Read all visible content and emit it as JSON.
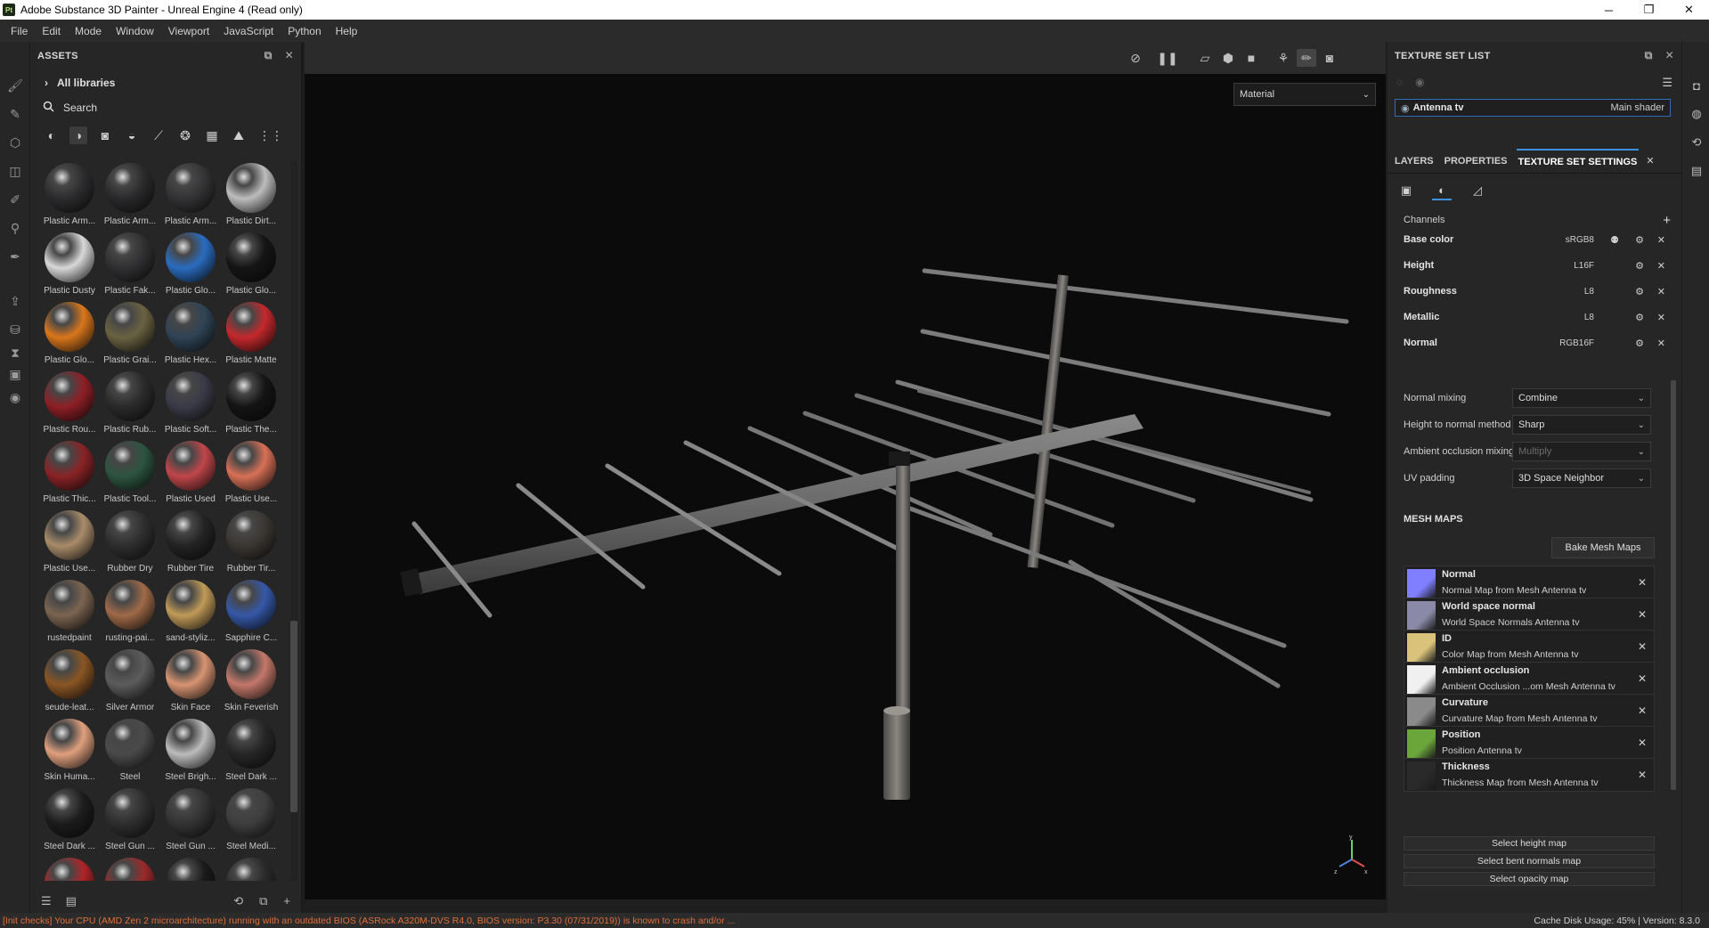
{
  "window": {
    "logo": "Pt",
    "title": "Adobe Substance 3D Painter - Unreal Engine 4 (Read only)",
    "controls": {
      "minimize": "─",
      "maximize": "❐",
      "close": "✕"
    }
  },
  "menu": [
    "File",
    "Edit",
    "Mode",
    "Window",
    "Viewport",
    "JavaScript",
    "Python",
    "Help"
  ],
  "assets": {
    "header": "ASSETS",
    "library": "All libraries",
    "search_placeholder": "Search",
    "items": [
      {
        "label": "Plastic Arm...",
        "color": "#2c2c2e"
      },
      {
        "label": "Plastic Arm...",
        "color": "#2a2a2c"
      },
      {
        "label": "Plastic Arm...",
        "color": "#333335"
      },
      {
        "label": "Plastic Dirt...",
        "color": "#bdbdbd"
      },
      {
        "label": "Plastic Dusty",
        "color": "#d8d8d8"
      },
      {
        "label": "Plastic Fak...",
        "color": "#303032"
      },
      {
        "label": "Plastic Glo...",
        "color": "#2a6cc0"
      },
      {
        "label": "Plastic Glo...",
        "color": "#151515"
      },
      {
        "label": "Plastic Glo...",
        "color": "#d9771c"
      },
      {
        "label": "Plastic Grai...",
        "color": "#6b6241"
      },
      {
        "label": "Plastic Hex...",
        "color": "#2f4456"
      },
      {
        "label": "Plastic Matte",
        "color": "#c5282c"
      },
      {
        "label": "Plastic Rou...",
        "color": "#8e1f26"
      },
      {
        "label": "Plastic Rub...",
        "color": "#2a2a2a"
      },
      {
        "label": "Plastic Soft...",
        "color": "#3a3a48"
      },
      {
        "label": "Plastic The...",
        "color": "#141414"
      },
      {
        "label": "Plastic Thic...",
        "color": "#8a2326"
      },
      {
        "label": "Plastic Tool...",
        "color": "#2c5440"
      },
      {
        "label": "Plastic Used",
        "color": "#c0464a"
      },
      {
        "label": "Plastic Use...",
        "color": "#d87056"
      },
      {
        "label": "Plastic Use...",
        "color": "#a98c6a"
      },
      {
        "label": "Rubber Dry",
        "color": "#2e2e2e"
      },
      {
        "label": "Rubber Tire",
        "color": "#232323"
      },
      {
        "label": "Rubber Tir...",
        "color": "#3a3632"
      },
      {
        "label": "rustedpaint",
        "color": "#7b6450"
      },
      {
        "label": "rusting-pai...",
        "color": "#a06a48"
      },
      {
        "label": "sand-styliz...",
        "color": "#c09a58"
      },
      {
        "label": "Sapphire C...",
        "color": "#3558a8"
      },
      {
        "label": "seude-leat...",
        "color": "#8a5524"
      },
      {
        "label": "Silver Armor",
        "color": "#5c5c5c"
      },
      {
        "label": "Skin Face",
        "color": "#d89472"
      },
      {
        "label": "Skin Feverish",
        "color": "#c4786a"
      },
      {
        "label": "Skin Huma...",
        "color": "#e0a07e"
      },
      {
        "label": "Steel",
        "color": "#4a4a4a"
      },
      {
        "label": "Steel Brigh...",
        "color": "#bcbcbc"
      },
      {
        "label": "Steel Dark ...",
        "color": "#262626"
      },
      {
        "label": "Steel Dark ...",
        "color": "#1c1c1c"
      },
      {
        "label": "Steel Gun ...",
        "color": "#2e2e2e"
      },
      {
        "label": "Steel Gun ...",
        "color": "#333333"
      },
      {
        "label": "Steel Medi...",
        "color": "#3e3e3e"
      },
      {
        "label": "",
        "color": "#b02428"
      },
      {
        "label": "",
        "color": "#9c2a2a"
      },
      {
        "label": "",
        "color": "#1a1a1a"
      },
      {
        "label": "",
        "color": "#2a2a2a"
      }
    ]
  },
  "viewport": {
    "mode": "Material"
  },
  "texture_set_list": {
    "header": "TEXTURE SET LIST",
    "set_name": "Antenna tv",
    "shader": "Main shader"
  },
  "tabs": [
    {
      "label": "LAYERS"
    },
    {
      "label": "PROPERTIES"
    },
    {
      "label": "TEXTURE SET SETTINGS"
    }
  ],
  "tab_close": "✕",
  "channels": {
    "header": "Channels",
    "items": [
      {
        "name": "Base color",
        "format": "sRGB8"
      },
      {
        "name": "Height",
        "format": "L16F"
      },
      {
        "name": "Roughness",
        "format": "L8"
      },
      {
        "name": "Metallic",
        "format": "L8"
      },
      {
        "name": "Normal",
        "format": "RGB16F"
      }
    ]
  },
  "settings": [
    {
      "label": "Normal mixing",
      "value": "Combine"
    },
    {
      "label": "Height to normal method",
      "value": "Sharp"
    },
    {
      "label": "Ambient occlusion mixing",
      "value": "Multiply"
    },
    {
      "label": "UV padding",
      "value": "3D Space Neighbor"
    }
  ],
  "mesh_maps": {
    "header": "MESH MAPS",
    "bake_button": "Bake Mesh Maps",
    "items": [
      {
        "title": "Normal",
        "subtitle": "Normal Map from Mesh Antenna tv",
        "color": "#7f7fff"
      },
      {
        "title": "World space normal",
        "subtitle": "World Space Normals Antenna tv",
        "color": "#8a8aa8"
      },
      {
        "title": "ID",
        "subtitle": "Color Map from Mesh Antenna tv",
        "color": "#d9c27a"
      },
      {
        "title": "Ambient occlusion",
        "subtitle": "Ambient Occlusion ...om Mesh Antenna tv",
        "color": "#f0f0f0"
      },
      {
        "title": "Curvature",
        "subtitle": "Curvature Map from Mesh Antenna tv",
        "color": "#8a8a8a"
      },
      {
        "title": "Position",
        "subtitle": "Position Antenna tv",
        "color": "#6aa63a"
      },
      {
        "title": "Thickness",
        "subtitle": "Thickness Map from Mesh Antenna tv",
        "color": "#2a2a2a"
      }
    ],
    "select_buttons": [
      "Select height map",
      "Select bent normals map",
      "Select opacity map"
    ]
  },
  "status": {
    "message": "[Init checks] Your CPU (AMD Zen 2 microarchitecture) running with an outdated BIOS (ASRock A320M-DVS R4.0, BIOS version: P3.30 (07/31/2019)) is known to crash and/or ...",
    "right": "Cache Disk Usage:   45% | Version: 8.3.0"
  },
  "colors": {
    "accent": "#3d8fdf",
    "warning": "#e0703a",
    "panel_bg": "#262626"
  }
}
